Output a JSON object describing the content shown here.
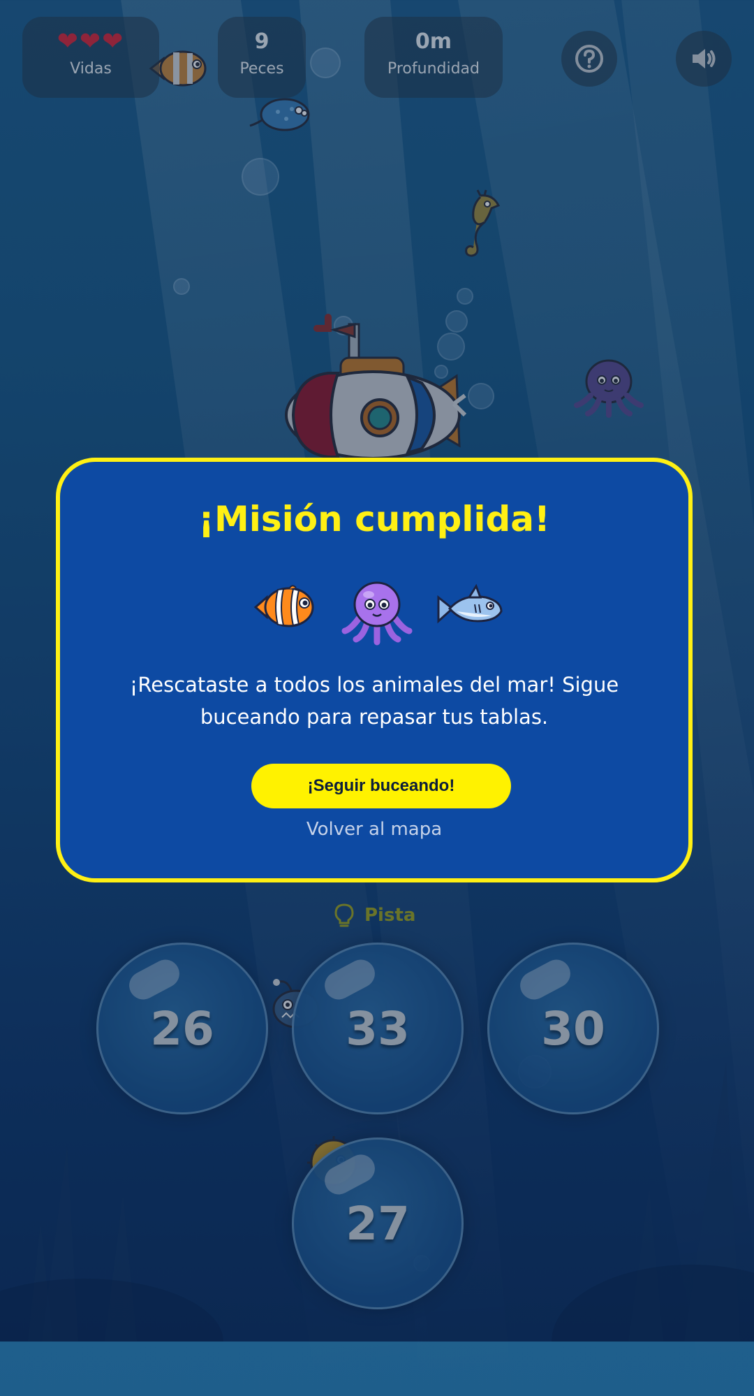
{
  "hud": {
    "lives": {
      "hearts": "❤❤❤",
      "label": "Vidas"
    },
    "fish": {
      "value": "9",
      "label": "Peces"
    },
    "depth": {
      "value": "0m",
      "label": "Profundidad"
    }
  },
  "icons": {
    "help": "help-icon",
    "sound": "sound-icon",
    "hint": "lightbulb-icon"
  },
  "modal": {
    "title": "¡Misión cumplida!",
    "message": "¡Rescataste a todos los animales del mar! Sigue buceando para repasar tus tablas.",
    "primary_button": "¡Seguir buceando!",
    "secondary_link": "Volver al mapa",
    "animals": [
      "clownfish",
      "octopus",
      "shark"
    ]
  },
  "hint_label": "Pista",
  "answers": [
    {
      "value": "26"
    },
    {
      "value": "33"
    },
    {
      "value": "30"
    },
    {
      "value": "27"
    }
  ],
  "colors": {
    "modal_bg": "#0d4aa3",
    "modal_border": "#fff014",
    "button_bg": "#fff200",
    "hint": "#9ea41f"
  }
}
